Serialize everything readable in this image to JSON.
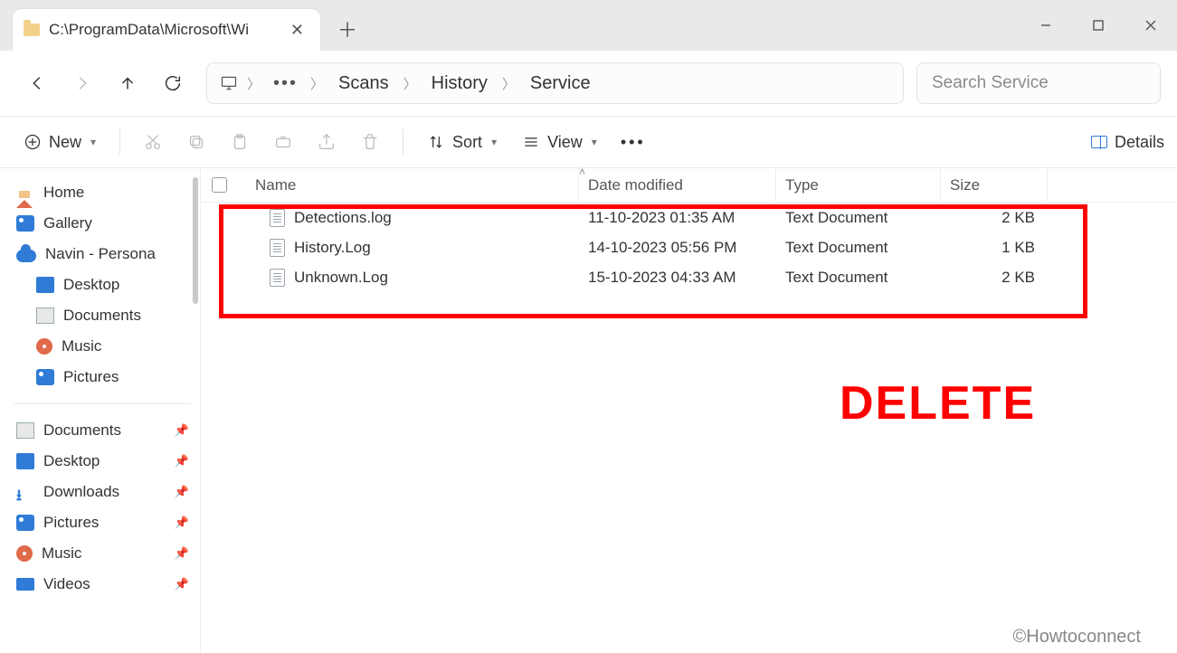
{
  "tab": {
    "title": "C:\\ProgramData\\Microsoft\\Wi"
  },
  "breadcrumb": {
    "items": [
      "Scans",
      "History",
      "Service"
    ]
  },
  "search": {
    "placeholder": "Search Service"
  },
  "commands": {
    "new_label": "New",
    "sort_label": "Sort",
    "view_label": "View",
    "details_label": "Details"
  },
  "sidebar": {
    "top": [
      {
        "label": "Home"
      },
      {
        "label": "Gallery"
      },
      {
        "label": "Navin - Persona"
      }
    ],
    "persona_children": [
      {
        "label": "Desktop"
      },
      {
        "label": "Documents"
      },
      {
        "label": "Music"
      },
      {
        "label": "Pictures"
      }
    ],
    "quick": [
      {
        "label": "Documents"
      },
      {
        "label": "Desktop"
      },
      {
        "label": "Downloads"
      },
      {
        "label": "Pictures"
      },
      {
        "label": "Music"
      },
      {
        "label": "Videos"
      }
    ]
  },
  "columns": {
    "name": "Name",
    "date": "Date modified",
    "type": "Type",
    "size": "Size"
  },
  "files": [
    {
      "name": "Detections.log",
      "date": "11-10-2023 01:35 AM",
      "type": "Text Document",
      "size": "2 KB"
    },
    {
      "name": "History.Log",
      "date": "14-10-2023 05:56 PM",
      "type": "Text Document",
      "size": "1 KB"
    },
    {
      "name": "Unknown.Log",
      "date": "15-10-2023 04:33 AM",
      "type": "Text Document",
      "size": "2 KB"
    }
  ],
  "annotation": {
    "delete_label": "DELETE"
  },
  "watermark": "©Howtoconnect"
}
